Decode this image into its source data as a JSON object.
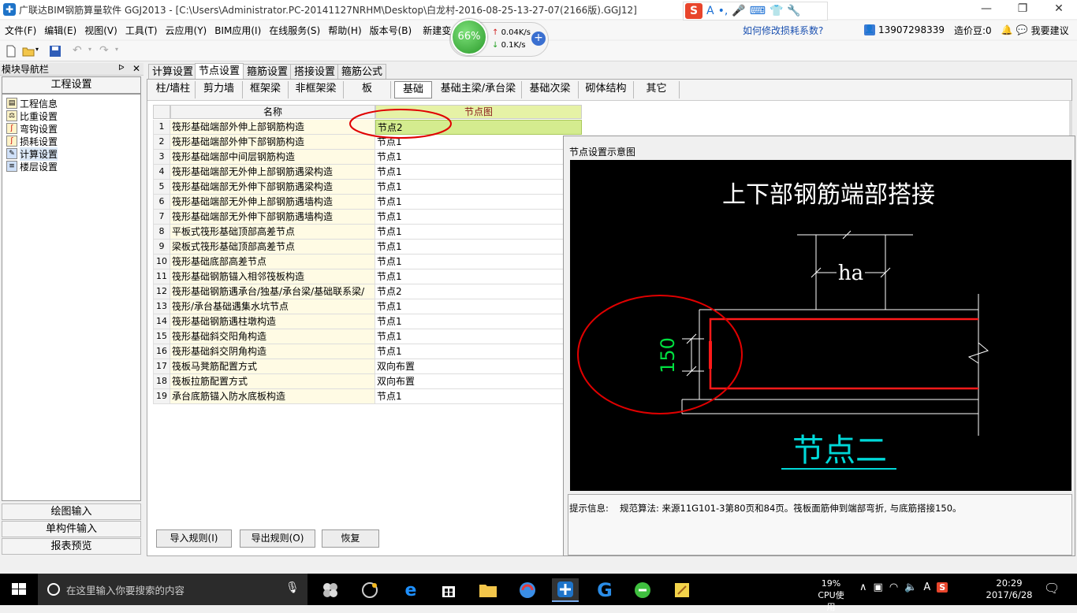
{
  "window": {
    "title": "广联达BIM钢筋算量软件 GGJ2013 - [C:\\Users\\Administrator.PC-20141127NRHM\\Desktop\\白龙村-2016-08-25-13-27-07(2166版).GGJ12]",
    "minimize": "—",
    "maximize": "❐",
    "close": "✕"
  },
  "ime": {
    "logo": "S",
    "items": [
      "A",
      "•,",
      "🎤",
      "⌨",
      "👕",
      "🔧"
    ]
  },
  "menu": {
    "items": [
      "文件(F)",
      "编辑(E)",
      "视图(V)",
      "工具(T)",
      "云应用(Y)",
      "BIM应用(I)",
      "在线服务(S)",
      "帮助(H)",
      "版本号(B)",
      "新建变"
    ],
    "help_link": "如何修改损耗系数?",
    "phone": "13907298339",
    "price_label": "造价豆:0",
    "suggest": "我要建议"
  },
  "net": {
    "percent": "66%",
    "up": "0.04K/s",
    "down": "0.1K/s"
  },
  "nav": {
    "header": "模块导航栏",
    "pin": "ᐅ",
    "close": "✕",
    "section_project": "工程设置",
    "items": [
      {
        "label": "工程信息",
        "icon": "folder-icon"
      },
      {
        "label": "比重设置",
        "icon": "weight-icon"
      },
      {
        "label": "弯钩设置",
        "icon": "hook-icon"
      },
      {
        "label": "损耗设置",
        "icon": "loss-icon"
      },
      {
        "label": "计算设置",
        "icon": "calc-icon"
      },
      {
        "label": "楼层设置",
        "icon": "floor-icon"
      }
    ],
    "sections_bottom": [
      "绘图输入",
      "单构件输入",
      "报表预览"
    ]
  },
  "main_tabs": [
    "计算设置",
    "节点设置",
    "箍筋设置",
    "搭接设置",
    "箍筋公式"
  ],
  "active_main_tab": 1,
  "sub_tabs": [
    "柱/墙柱",
    "剪力墙",
    "框架梁",
    "非框架梁",
    "板",
    "基础",
    "基础主梁/承台梁",
    "基础次梁",
    "砌体结构",
    "其它"
  ],
  "active_sub_tab": 5,
  "grid": {
    "headers": {
      "name": "名称",
      "node": "节点图"
    },
    "rows": [
      {
        "n": "1",
        "name": "筏形基础端部外伸上部钢筋构造",
        "value": "节点2"
      },
      {
        "n": "2",
        "name": "筏形基础端部外伸下部钢筋构造",
        "value": "节点1"
      },
      {
        "n": "3",
        "name": "筏形基础端部中间层钢筋构造",
        "value": "节点1"
      },
      {
        "n": "4",
        "name": "筏形基础端部无外伸上部钢筋遇梁构造",
        "value": "节点1"
      },
      {
        "n": "5",
        "name": "筏形基础端部无外伸下部钢筋遇梁构造",
        "value": "节点1"
      },
      {
        "n": "6",
        "name": "筏形基础端部无外伸上部钢筋遇墙构造",
        "value": "节点1"
      },
      {
        "n": "7",
        "name": "筏形基础端部无外伸下部钢筋遇墙构造",
        "value": "节点1"
      },
      {
        "n": "8",
        "name": "平板式筏形基础顶部高差节点",
        "value": "节点1"
      },
      {
        "n": "9",
        "name": "梁板式筏形基础顶部高差节点",
        "value": "节点1"
      },
      {
        "n": "10",
        "name": "筏形基础底部高差节点",
        "value": "节点1"
      },
      {
        "n": "11",
        "name": "筏形基础钢筋锚入相邻筏板构造",
        "value": "节点1"
      },
      {
        "n": "12",
        "name": "筏形基础钢筋遇承台/独基/承台梁/基础联系梁/",
        "value": "节点2"
      },
      {
        "n": "13",
        "name": "筏形/承台基础遇集水坑节点",
        "value": "节点1"
      },
      {
        "n": "14",
        "name": "筏形基础钢筋遇柱墩构造",
        "value": "节点1"
      },
      {
        "n": "15",
        "name": "筏形基础斜交阳角构造",
        "value": "节点1"
      },
      {
        "n": "16",
        "name": "筏形基础斜交阴角构造",
        "value": "节点1"
      },
      {
        "n": "17",
        "name": "筏板马凳筋配置方式",
        "value": "双向布置"
      },
      {
        "n": "18",
        "name": "筏板拉筋配置方式",
        "value": "双向布置"
      },
      {
        "n": "19",
        "name": "承台底筋锚入防水底板构造",
        "value": "节点1"
      }
    ]
  },
  "diagram": {
    "panel_title": "节点设置示意图",
    "heading": "上下部钢筋端部搭接",
    "dim_ha": "ha",
    "dim_150": "150",
    "node_label": "节点二",
    "colors": {
      "red": "#ff1a1a",
      "white": "#ffffff",
      "green": "#00e040",
      "cyan": "#00d8d8",
      "annotation": "#e00000"
    }
  },
  "hint": {
    "label": "提示信息:",
    "text": "规范算法: 来源11G101-3第80页和84页。筏板面筋伸到端部弯折, 与底筋搭接150。"
  },
  "buttons": {
    "import": "导入规则(I)",
    "export": "导出规则(O)",
    "restore": "恢复"
  },
  "taskbar": {
    "search_placeholder": "在这里输入你要搜索的内容",
    "cpu_percent": "19%",
    "cpu_label": "CPU使用",
    "time": "20:29",
    "date": "2017/6/28",
    "tray_ime": "A"
  }
}
